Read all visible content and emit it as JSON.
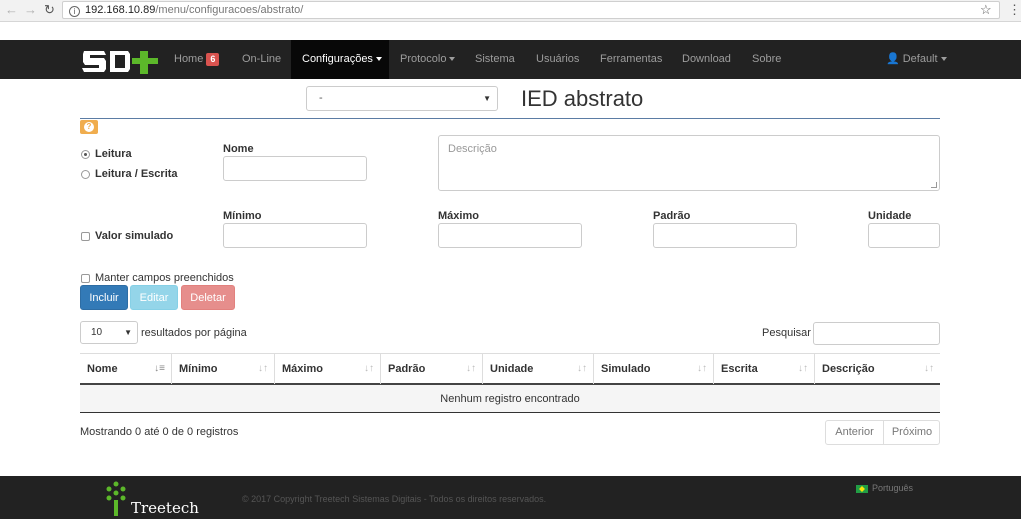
{
  "browser": {
    "url_host": "192.168.10.89",
    "url_path": "/menu/configuracoes/abstrato/"
  },
  "navbar": {
    "items": [
      {
        "label": "Home",
        "badge": "6"
      },
      {
        "label": "On-Line"
      },
      {
        "label": "Configurações"
      },
      {
        "label": "Protocolo"
      },
      {
        "label": "Sistema"
      },
      {
        "label": "Usuários"
      },
      {
        "label": "Ferramentas"
      },
      {
        "label": "Download"
      },
      {
        "label": "Sobre"
      }
    ],
    "user": "Default"
  },
  "header": {
    "ied_select_value": "-",
    "title": "IED abstrato"
  },
  "form": {
    "radio_read": "Leitura",
    "radio_rw": "Leitura / Escrita",
    "nome_label": "Nome",
    "descricao_placeholder": "Descrição",
    "valor_simulado": "Valor simulado",
    "minimo_label": "Mínimo",
    "maximo_label": "Máximo",
    "padrao_label": "Padrão",
    "unidade_label": "Unidade",
    "manter": "Manter campos preenchidos",
    "incluir": "Incluir",
    "editar": "Editar",
    "deletar": "Deletar"
  },
  "table": {
    "length_value": "10",
    "length_label": "resultados por página",
    "search_label": "Pesquisar",
    "columns": [
      "Nome",
      "Mínimo",
      "Máximo",
      "Padrão",
      "Unidade",
      "Simulado",
      "Escrita",
      "Descrição"
    ],
    "empty": "Nenhum registro encontrado",
    "info": "Mostrando 0 até 0 de 0 registros",
    "prev": "Anterior",
    "next": "Próximo"
  },
  "footer": {
    "brand": "Treetech",
    "copyright": "© 2017 Copyright Treetech Sistemas Digitais - Todos os direitos reservados.",
    "language": "Português"
  }
}
